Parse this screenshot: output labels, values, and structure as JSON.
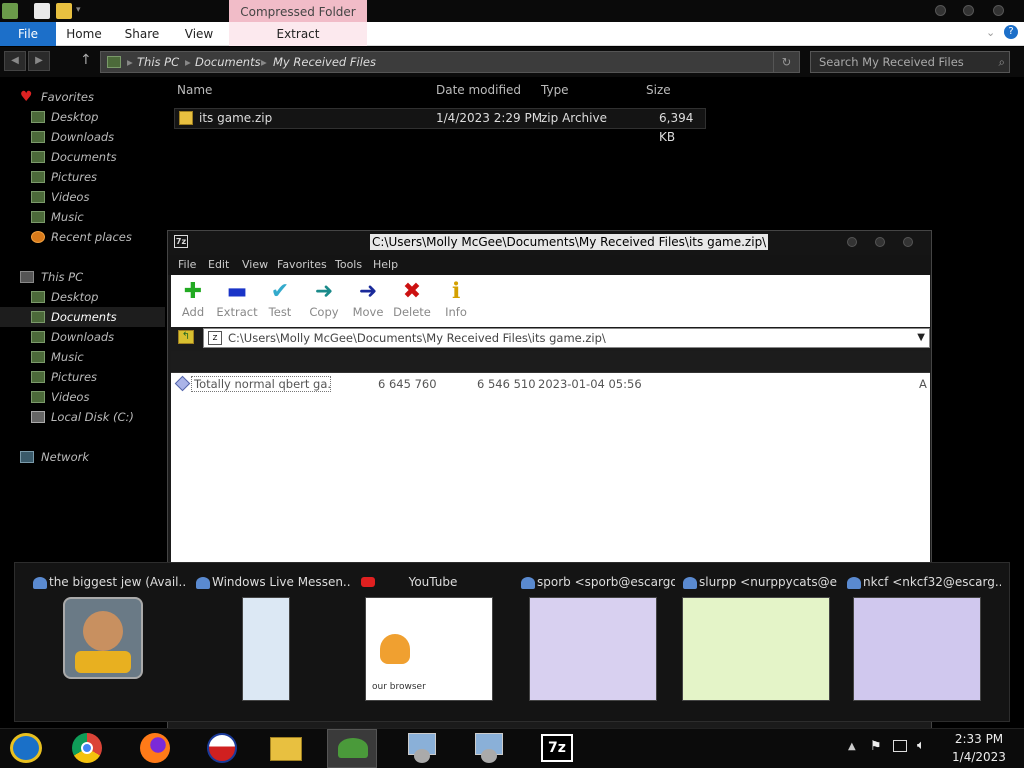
{
  "explorer": {
    "context_tab": "Compressed Folder Tools",
    "tabs": {
      "file": "File",
      "home": "Home",
      "share": "Share",
      "view": "View",
      "extract": "Extract"
    },
    "breadcrumb": [
      "This PC",
      "Documents",
      "My Received Files"
    ],
    "search_placeholder": "Search My Received Files",
    "nav": {
      "favorites": "Favorites",
      "fav_items": [
        "Desktop",
        "Downloads",
        "Documents",
        "Pictures",
        "Videos",
        "Music",
        "Recent places"
      ],
      "this_pc": "This PC",
      "pc_items": [
        "Desktop",
        "Documents",
        "Downloads",
        "Music",
        "Pictures",
        "Videos",
        "Local Disk (C:)"
      ],
      "network": "Network"
    },
    "columns": {
      "name": "Name",
      "date": "Date modified",
      "type": "Type",
      "size": "Size"
    },
    "file": {
      "name": "its game.zip",
      "date": "1/4/2023 2:29 PM",
      "type": "zip Archive",
      "size": "6,394 KB"
    }
  },
  "sevenzip": {
    "title": "C:\\Users\\Molly McGee\\Documents\\My Received Files\\its game.zip\\",
    "menu": [
      "File",
      "Edit",
      "View",
      "Favorites",
      "Tools",
      "Help"
    ],
    "toolbar": [
      {
        "label": "Add",
        "icon": "plus-icon",
        "color": "#22aa22",
        "glyph": "✚"
      },
      {
        "label": "Extract",
        "icon": "minus-icon",
        "color": "#1a34c8",
        "glyph": "▬"
      },
      {
        "label": "Test",
        "icon": "check-icon",
        "color": "#33aacc",
        "glyph": "✔"
      },
      {
        "label": "Copy",
        "icon": "copy-arrow-icon",
        "color": "#1a8a8a",
        "glyph": "➜"
      },
      {
        "label": "Move",
        "icon": "move-arrow-icon",
        "color": "#1a2a9a",
        "glyph": "➜"
      },
      {
        "label": "Delete",
        "icon": "delete-icon",
        "color": "#cc1111",
        "glyph": "✖"
      },
      {
        "label": "Info",
        "icon": "info-icon",
        "color": "#d4a000",
        "glyph": "ℹ"
      }
    ],
    "path": "C:\\Users\\Molly McGee\\Documents\\My Received Files\\its game.zip\\",
    "row": {
      "name": "Totally normal qbert ga...",
      "size": "6 645 760",
      "packed": "6 546 510",
      "modified": "2023-01-04 05:56",
      "attr": "A"
    }
  },
  "thumbnails": [
    {
      "title": "the biggest jew (Avail...",
      "icon": "messenger-icon"
    },
    {
      "title": "Windows Live Messen...",
      "icon": "messenger-icon"
    },
    {
      "title": "YouTube",
      "icon": "youtube-icon",
      "page_text": "our browser"
    },
    {
      "title": "sporb <sporb@escargo...",
      "icon": "messenger-icon"
    },
    {
      "title": "slurpp <nurppycats@es...",
      "icon": "messenger-icon"
    },
    {
      "title": "nkcf <nkcf32@escarg...",
      "icon": "messenger-icon"
    }
  ],
  "clock": {
    "time": "2:33 PM",
    "date": "1/4/2023"
  },
  "colors": {
    "accent": "#1c6fc9",
    "context_tab": "#f1bcc8"
  }
}
